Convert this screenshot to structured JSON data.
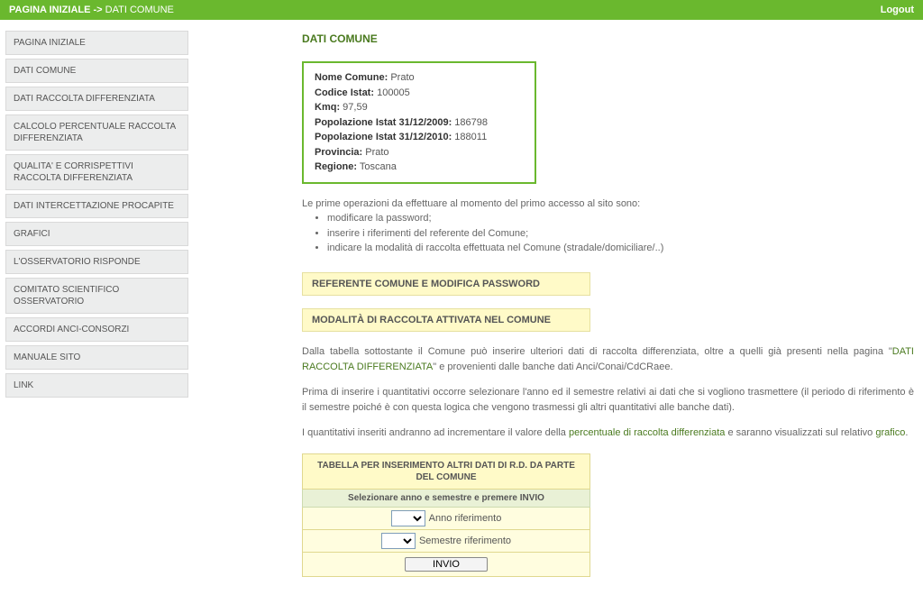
{
  "topbar": {
    "crumb_home": "PAGINA INIZIALE",
    "crumb_sep": "->",
    "crumb_current": "DATI COMUNE",
    "logout": "Logout"
  },
  "sidebar": {
    "items": [
      "PAGINA INIZIALE",
      "DATI COMUNE",
      "DATI RACCOLTA DIFFERENZIATA",
      "CALCOLO PERCENTUALE RACCOLTA DIFFERENZIATA",
      "QUALITA' E CORRISPETTIVI RACCOLTA DIFFERENZIATA",
      "DATI INTERCETTAZIONE PROCAPITE",
      "GRAFICI",
      "L'OSSERVATORIO RISPONDE",
      "COMITATO SCIENTIFICO OSSERVATORIO",
      "ACCORDI ANCI-CONSORZI",
      "MANUALE SITO",
      "LINK"
    ]
  },
  "main": {
    "title": "DATI COMUNE",
    "info": {
      "nome_comune_l": "Nome Comune:",
      "nome_comune_v": "Prato",
      "codice_istat_l": "Codice Istat:",
      "codice_istat_v": "100005",
      "kmq_l": "Kmq:",
      "kmq_v": "97,59",
      "pop2009_l": "Popolazione Istat 31/12/2009:",
      "pop2009_v": "186798",
      "pop2010_l": "Popolazione Istat 31/12/2010:",
      "pop2010_v": "188011",
      "provincia_l": "Provincia:",
      "provincia_v": "Prato",
      "regione_l": "Regione:",
      "regione_v": "Toscana"
    },
    "intro_lead": "Le prime operazioni da effettuare al momento del primo accesso al sito sono:",
    "intro_items": [
      "modificare la password;",
      "inserire i riferimenti del referente del Comune;",
      "indicare la modalità di raccolta effettuata nel Comune (stradale/domiciliare/..)"
    ],
    "bar1": "REFERENTE COMUNE E MODIFICA PASSWORD",
    "bar2": "MODALITÀ DI RACCOLTA ATTIVATA NEL COMUNE",
    "para1_a": "Dalla tabella sottostante il Comune può inserire ulteriori dati di raccolta differenziata, oltre a quelli già presenti nella pagina \"",
    "para1_link": "DATI RACCOLTA DIFFERENZIATA",
    "para1_b": "\" e provenienti dalle banche dati Anci/Conai/CdCRaee.",
    "para2": "Prima di inserire i quantitativi occorre selezionare l'anno ed il semestre relativi ai dati che si vogliono trasmettere (il periodo di riferimento è il semestre poiché è con questa logica che vengono trasmessi gli altri quantitativi alle banche dati).",
    "para3_a": "I quantitativi inseriti andranno ad incrementare il valore della ",
    "para3_link1": "percentuale di raccolta differenziata",
    "para3_b": " e saranno visualizzati sul relativo ",
    "para3_link2": "grafico",
    "para3_c": ".",
    "form": {
      "header": "TABELLA PER INSERIMENTO ALTRI DATI DI R.D. DA PARTE DEL COMUNE",
      "subheader": "Selezionare anno e semestre e premere INVIO",
      "anno_label": "Anno riferimento",
      "semestre_label": "Semestre riferimento",
      "submit": "INVIO"
    }
  }
}
